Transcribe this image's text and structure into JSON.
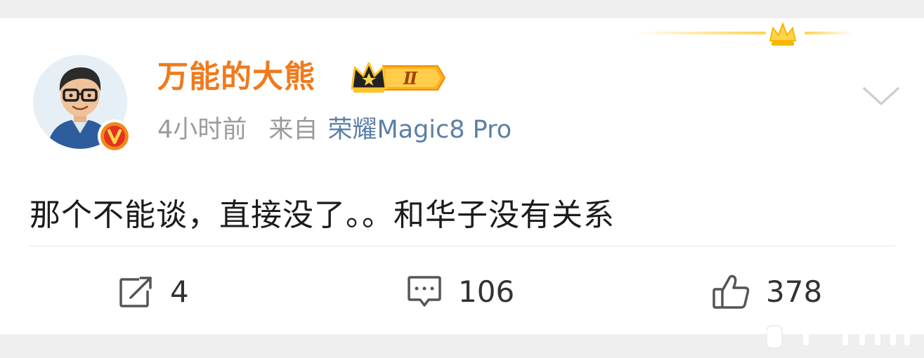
{
  "post": {
    "author": {
      "name": "万能的大熊",
      "avatar_icon": "cartoon-avatar-man-glasses",
      "verified_icon": "verified-v-badge",
      "level_badge_text": "Ⅱ"
    },
    "meta": {
      "time": "4小时前",
      "source_prefix": "来自",
      "device": "荣耀Magic8 Pro"
    },
    "text": "那个不能谈，直接没了。。和华子没有关系",
    "actions": {
      "repost_count": "4",
      "comment_count": "106",
      "like_count": "378"
    }
  },
  "colors": {
    "username": "#f07a1c",
    "device_link": "#5b7fa6",
    "meta_gray": "#9b9b9b",
    "crown_gold": "#ffd34d"
  }
}
